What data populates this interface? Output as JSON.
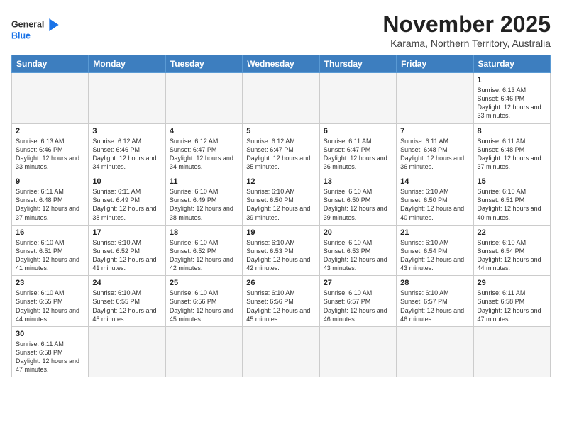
{
  "header": {
    "title": "November 2025",
    "subtitle": "Karama, Northern Territory, Australia"
  },
  "logo": {
    "line1": "General",
    "line2": "Blue"
  },
  "weekdays": [
    "Sunday",
    "Monday",
    "Tuesday",
    "Wednesday",
    "Thursday",
    "Friday",
    "Saturday"
  ],
  "weeks": [
    [
      {
        "day": "",
        "info": ""
      },
      {
        "day": "",
        "info": ""
      },
      {
        "day": "",
        "info": ""
      },
      {
        "day": "",
        "info": ""
      },
      {
        "day": "",
        "info": ""
      },
      {
        "day": "",
        "info": ""
      },
      {
        "day": "1",
        "info": "Sunrise: 6:13 AM\nSunset: 6:46 PM\nDaylight: 12 hours and 33 minutes."
      }
    ],
    [
      {
        "day": "2",
        "info": "Sunrise: 6:13 AM\nSunset: 6:46 PM\nDaylight: 12 hours and 33 minutes."
      },
      {
        "day": "3",
        "info": "Sunrise: 6:12 AM\nSunset: 6:46 PM\nDaylight: 12 hours and 34 minutes."
      },
      {
        "day": "4",
        "info": "Sunrise: 6:12 AM\nSunset: 6:47 PM\nDaylight: 12 hours and 34 minutes."
      },
      {
        "day": "5",
        "info": "Sunrise: 6:12 AM\nSunset: 6:47 PM\nDaylight: 12 hours and 35 minutes."
      },
      {
        "day": "6",
        "info": "Sunrise: 6:11 AM\nSunset: 6:47 PM\nDaylight: 12 hours and 36 minutes."
      },
      {
        "day": "7",
        "info": "Sunrise: 6:11 AM\nSunset: 6:48 PM\nDaylight: 12 hours and 36 minutes."
      },
      {
        "day": "8",
        "info": "Sunrise: 6:11 AM\nSunset: 6:48 PM\nDaylight: 12 hours and 37 minutes."
      }
    ],
    [
      {
        "day": "9",
        "info": "Sunrise: 6:11 AM\nSunset: 6:48 PM\nDaylight: 12 hours and 37 minutes."
      },
      {
        "day": "10",
        "info": "Sunrise: 6:11 AM\nSunset: 6:49 PM\nDaylight: 12 hours and 38 minutes."
      },
      {
        "day": "11",
        "info": "Sunrise: 6:10 AM\nSunset: 6:49 PM\nDaylight: 12 hours and 38 minutes."
      },
      {
        "day": "12",
        "info": "Sunrise: 6:10 AM\nSunset: 6:50 PM\nDaylight: 12 hours and 39 minutes."
      },
      {
        "day": "13",
        "info": "Sunrise: 6:10 AM\nSunset: 6:50 PM\nDaylight: 12 hours and 39 minutes."
      },
      {
        "day": "14",
        "info": "Sunrise: 6:10 AM\nSunset: 6:50 PM\nDaylight: 12 hours and 40 minutes."
      },
      {
        "day": "15",
        "info": "Sunrise: 6:10 AM\nSunset: 6:51 PM\nDaylight: 12 hours and 40 minutes."
      }
    ],
    [
      {
        "day": "16",
        "info": "Sunrise: 6:10 AM\nSunset: 6:51 PM\nDaylight: 12 hours and 41 minutes."
      },
      {
        "day": "17",
        "info": "Sunrise: 6:10 AM\nSunset: 6:52 PM\nDaylight: 12 hours and 41 minutes."
      },
      {
        "day": "18",
        "info": "Sunrise: 6:10 AM\nSunset: 6:52 PM\nDaylight: 12 hours and 42 minutes."
      },
      {
        "day": "19",
        "info": "Sunrise: 6:10 AM\nSunset: 6:53 PM\nDaylight: 12 hours and 42 minutes."
      },
      {
        "day": "20",
        "info": "Sunrise: 6:10 AM\nSunset: 6:53 PM\nDaylight: 12 hours and 43 minutes."
      },
      {
        "day": "21",
        "info": "Sunrise: 6:10 AM\nSunset: 6:54 PM\nDaylight: 12 hours and 43 minutes."
      },
      {
        "day": "22",
        "info": "Sunrise: 6:10 AM\nSunset: 6:54 PM\nDaylight: 12 hours and 44 minutes."
      }
    ],
    [
      {
        "day": "23",
        "info": "Sunrise: 6:10 AM\nSunset: 6:55 PM\nDaylight: 12 hours and 44 minutes."
      },
      {
        "day": "24",
        "info": "Sunrise: 6:10 AM\nSunset: 6:55 PM\nDaylight: 12 hours and 45 minutes."
      },
      {
        "day": "25",
        "info": "Sunrise: 6:10 AM\nSunset: 6:56 PM\nDaylight: 12 hours and 45 minutes."
      },
      {
        "day": "26",
        "info": "Sunrise: 6:10 AM\nSunset: 6:56 PM\nDaylight: 12 hours and 45 minutes."
      },
      {
        "day": "27",
        "info": "Sunrise: 6:10 AM\nSunset: 6:57 PM\nDaylight: 12 hours and 46 minutes."
      },
      {
        "day": "28",
        "info": "Sunrise: 6:10 AM\nSunset: 6:57 PM\nDaylight: 12 hours and 46 minutes."
      },
      {
        "day": "29",
        "info": "Sunrise: 6:11 AM\nSunset: 6:58 PM\nDaylight: 12 hours and 47 minutes."
      }
    ],
    [
      {
        "day": "30",
        "info": "Sunrise: 6:11 AM\nSunset: 6:58 PM\nDaylight: 12 hours and 47 minutes."
      },
      {
        "day": "",
        "info": ""
      },
      {
        "day": "",
        "info": ""
      },
      {
        "day": "",
        "info": ""
      },
      {
        "day": "",
        "info": ""
      },
      {
        "day": "",
        "info": ""
      },
      {
        "day": "",
        "info": ""
      }
    ]
  ]
}
